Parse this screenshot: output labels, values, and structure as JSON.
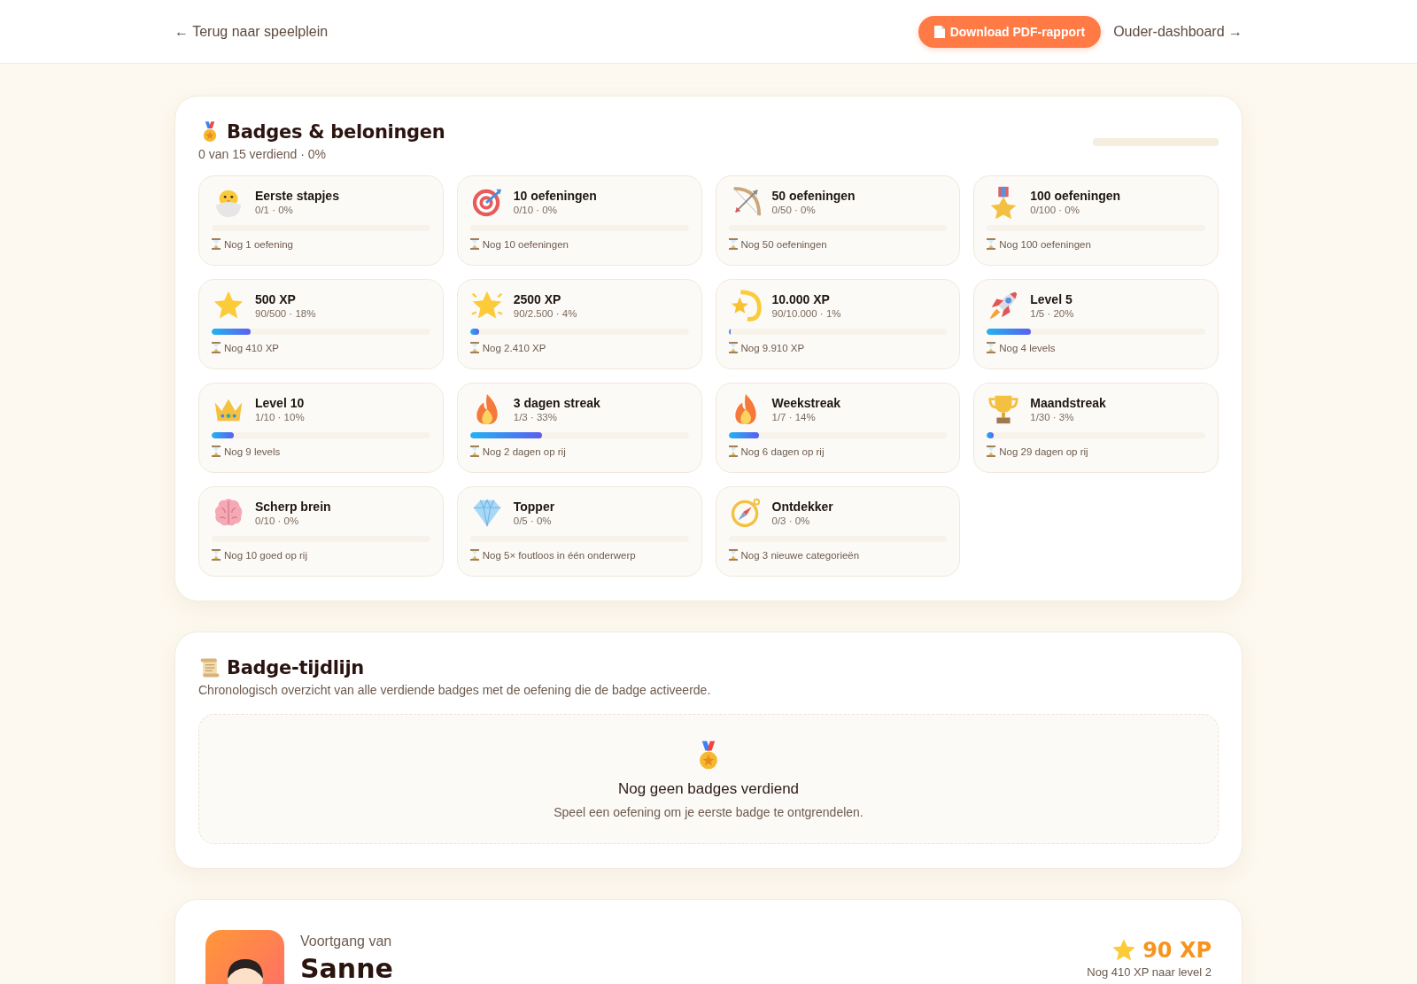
{
  "topbar": {
    "back_link": "← Terug naar speelplein",
    "download_button": "Download PDF-rapport",
    "dashboard_link": "Ouder-dashboard →"
  },
  "badges_section": {
    "title": "Badges & beloningen",
    "summary": "0 van 15 verdiend · 0%",
    "level": 0,
    "badges": [
      {
        "name": "Eerste stapjes",
        "progress": "0/1 · 0%",
        "level": 0,
        "remaining": "Nog 1 oefening"
      },
      {
        "name": "10 oefeningen",
        "progress": "0/10 · 0%",
        "level": 0,
        "remaining": "Nog 10 oefeningen"
      },
      {
        "name": "50 oefeningen",
        "progress": "0/50 · 0%",
        "level": 0,
        "remaining": "Nog 50 oefeningen"
      },
      {
        "name": "100 oefeningen",
        "progress": "0/100 · 0%",
        "level": 0,
        "remaining": "Nog 100 oefeningen"
      },
      {
        "name": "500 XP",
        "progress": "90/500 · 18%",
        "level": 0.18,
        "remaining": "Nog 410 XP"
      },
      {
        "name": "2500 XP",
        "progress": "90/2.500 · 4%",
        "level": 0.04,
        "remaining": "Nog 2.410 XP"
      },
      {
        "name": "10.000 XP",
        "progress": "90/10.000 · 1%",
        "level": 0.01,
        "remaining": "Nog 9.910 XP"
      },
      {
        "name": "Level 5",
        "progress": "1/5 · 20%",
        "level": 0.2,
        "remaining": "Nog 4 levels"
      },
      {
        "name": "Level 10",
        "progress": "1/10 · 10%",
        "level": 0.1,
        "remaining": "Nog 9 levels"
      },
      {
        "name": "3 dagen streak",
        "progress": "1/3 · 33%",
        "level": 0.33,
        "remaining": "Nog 2 dagen op rij"
      },
      {
        "name": "Weekstreak",
        "progress": "1/7 · 14%",
        "level": 0.14,
        "remaining": "Nog 6 dagen op rij"
      },
      {
        "name": "Maandstreak",
        "progress": "1/30 · 3%",
        "level": 0.03,
        "remaining": "Nog 29 dagen op rij"
      },
      {
        "name": "Scherp brein",
        "progress": "0/10 · 0%",
        "level": 0,
        "remaining": "Nog 10 goed op rij"
      },
      {
        "name": "Topper",
        "progress": "0/5 · 0%",
        "level": 0,
        "remaining": "Nog 5× foutloos in één onderwerp"
      },
      {
        "name": "Ontdekker",
        "progress": "0/3 · 0%",
        "level": 0,
        "remaining": "Nog 3 nieuwe categorieën"
      }
    ]
  },
  "timeline_section": {
    "title": "Badge-tijdlijn",
    "description": "Chronologisch overzicht van alle verdiende badges met de oefening die de badge activeerde.",
    "empty_title": "Nog geen badges verdiend",
    "empty_text": "Speel een oefening om je eerste badge te ontgrendelen."
  },
  "progress_section": {
    "label": "Voortgang van",
    "name": "Sanne",
    "xp": "90 XP",
    "next_level": "Nog 410 XP naar level 2"
  }
}
